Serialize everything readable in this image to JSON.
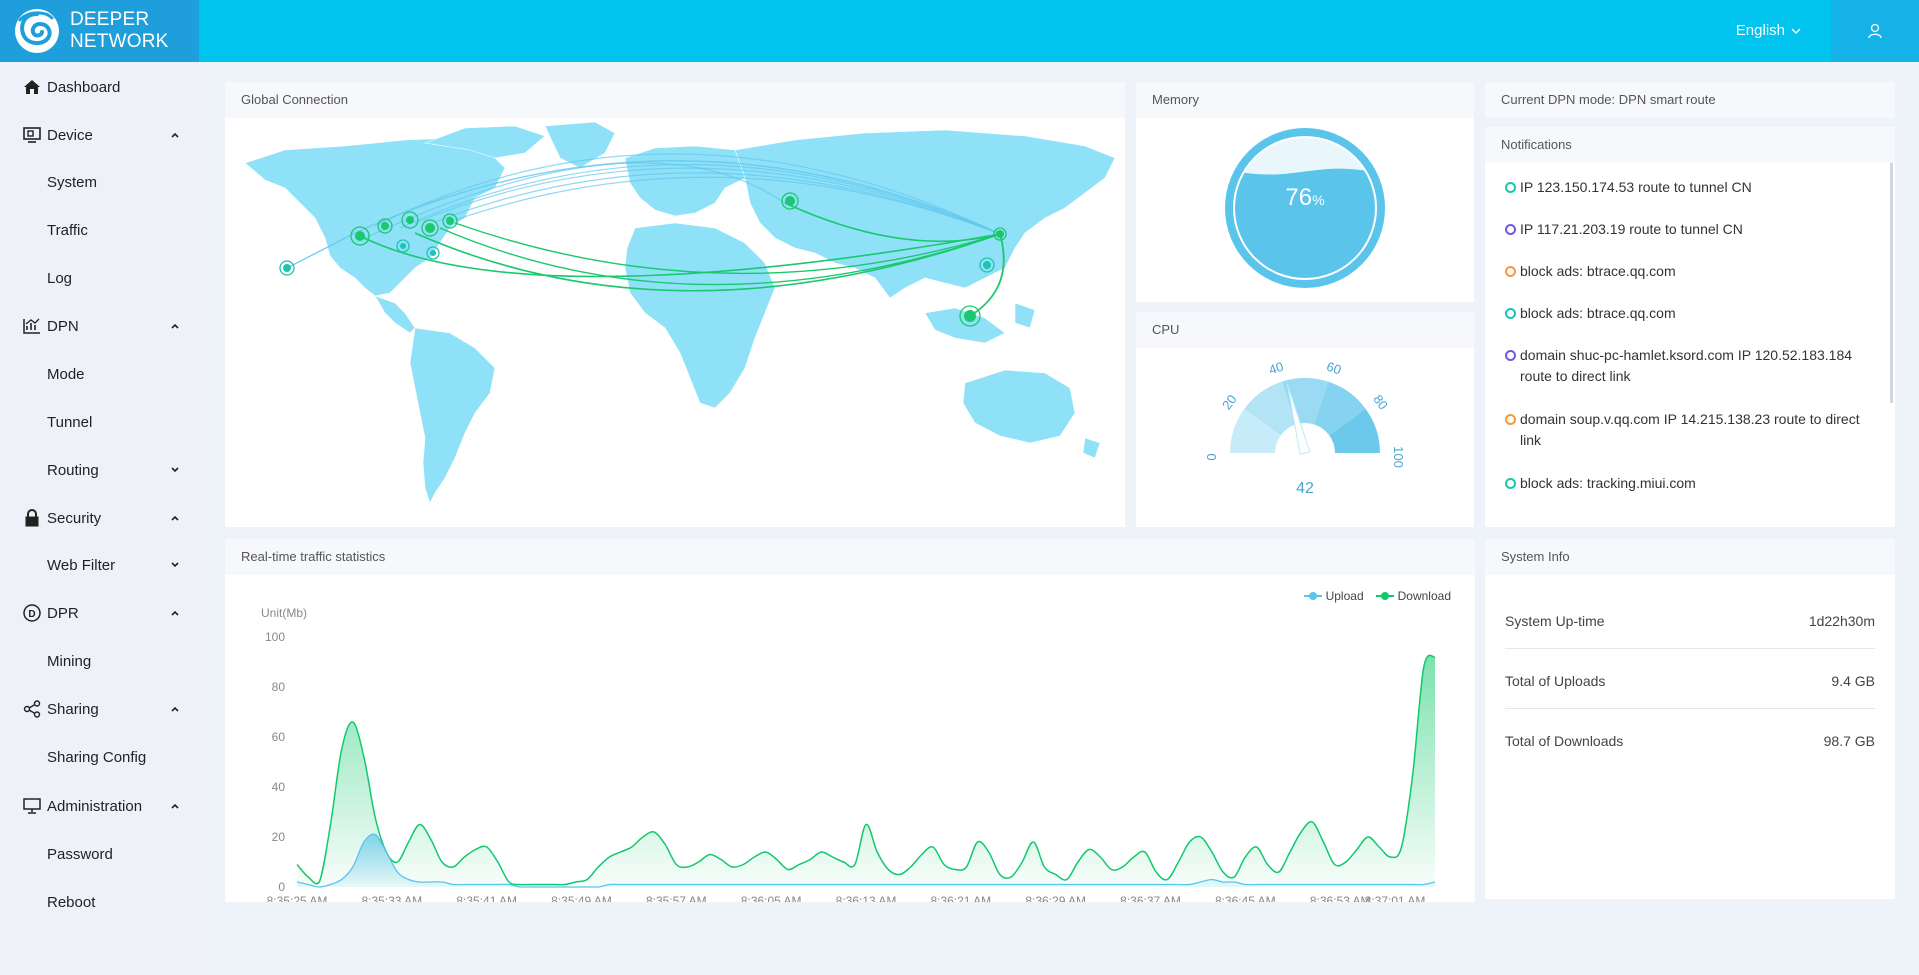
{
  "brand": {
    "line1": "DEEPER",
    "line2": "NETWORK"
  },
  "header": {
    "language": "English"
  },
  "sidebar": {
    "items": [
      {
        "label": "Dashboard",
        "icon": "home-icon"
      },
      {
        "label": "Device",
        "icon": "device-icon",
        "expanded": true
      },
      {
        "label": "System"
      },
      {
        "label": "Traffic"
      },
      {
        "label": "Log"
      },
      {
        "label": "DPN",
        "icon": "chart-icon",
        "expanded": true
      },
      {
        "label": "Mode"
      },
      {
        "label": "Tunnel"
      },
      {
        "label": "Routing",
        "expandable": true
      },
      {
        "label": "Security",
        "icon": "lock-icon",
        "expanded": true
      },
      {
        "label": "Web Filter",
        "expandable": true
      },
      {
        "label": "DPR",
        "icon": "dpr-coin-icon",
        "expanded": true
      },
      {
        "label": "Mining"
      },
      {
        "label": "Sharing",
        "icon": "share-icon",
        "expanded": true
      },
      {
        "label": "Sharing Config"
      },
      {
        "label": "Administration",
        "icon": "monitor-icon",
        "expanded": true
      },
      {
        "label": "Password"
      },
      {
        "label": "Reboot"
      }
    ]
  },
  "global_connection": {
    "title": "Global Connection"
  },
  "memory": {
    "title": "Memory",
    "value": "76",
    "unit": "%",
    "fraction": 0.76
  },
  "cpu": {
    "title": "CPU",
    "value": "42",
    "ticks": [
      "0",
      "20",
      "40",
      "60",
      "80",
      "100"
    ]
  },
  "dpn_mode": "Current DPN mode: DPN smart route",
  "notifications": {
    "title": "Notifications",
    "items": [
      {
        "text": "IP 123.150.174.53 route to tunnel CN",
        "color": "#1dc4b1"
      },
      {
        "text": "IP 117.21.203.19 route to tunnel CN",
        "color": "#6f5be0"
      },
      {
        "text": "block ads: btrace.qq.com",
        "color": "#f39a3d"
      },
      {
        "text": "block ads: btrace.qq.com",
        "color": "#1dc4b1"
      },
      {
        "text": "domain shuc-pc-hamlet.ksord.com IP 120.52.183.184 route to direct link",
        "color": "#6f5be0"
      },
      {
        "text": "domain soup.v.qq.com IP 14.215.138.23 route to direct link",
        "color": "#f39a3d"
      },
      {
        "text": "block ads: tracking.miui.com",
        "color": "#1dc4b1"
      }
    ]
  },
  "traffic": {
    "title": "Real-time traffic statistics",
    "unit_label": "Unit(Mb)",
    "legend_upload": "Upload",
    "legend_download": "Download"
  },
  "system_info": {
    "title": "System Info",
    "rows": [
      {
        "key": "System Up-time",
        "value": "1d22h30m"
      },
      {
        "key": "Total of Uploads",
        "value": "9.4 GB"
      },
      {
        "key": "Total of Downloads",
        "value": "98.7 GB"
      }
    ]
  },
  "colors": {
    "header": "#00c3ee",
    "logo_bg": "#1e9fdc",
    "upload": "#5bc4eb",
    "download": "#10c96b",
    "map": "#8fe1f8"
  },
  "chart_data": {
    "type": "area",
    "xlabel": "",
    "ylabel": "Unit(Mb)",
    "ylim": [
      0,
      100
    ],
    "yticks": [
      "0",
      "20",
      "40",
      "60",
      "80",
      "100"
    ],
    "xticks": [
      "8:35:25 AM",
      "8:35:33 AM",
      "8:35:41 AM",
      "8:35:49 AM",
      "8:35:57 AM",
      "8:36:05 AM",
      "8:36:13 AM",
      "8:36:21 AM",
      "8:36:29 AM",
      "8:36:37 AM",
      "8:36:45 AM",
      "8:36:53 AM",
      "8:37:01 AM"
    ],
    "x": [
      0,
      1,
      2,
      3,
      4,
      5,
      6,
      7,
      8,
      9,
      10,
      11,
      12,
      13,
      14,
      15,
      16,
      17,
      18,
      19,
      20,
      21,
      22,
      23,
      24,
      25,
      26,
      27,
      28,
      29,
      30,
      31,
      32,
      33,
      34,
      35,
      36,
      37,
      38,
      39,
      40,
      41,
      42,
      43,
      44,
      45,
      46,
      47,
      48,
      49,
      50,
      51,
      52,
      53,
      54,
      55,
      56,
      57,
      58,
      59,
      60,
      61,
      62,
      63,
      64,
      65,
      66,
      67,
      68,
      69,
      70,
      71,
      72,
      73,
      74,
      75,
      76,
      77,
      78,
      79,
      80,
      81,
      82,
      83,
      84,
      85,
      86,
      87,
      88,
      89,
      90,
      91,
      92,
      93,
      94,
      95,
      96,
      97,
      98,
      99,
      100,
      101,
      102
    ],
    "series": [
      {
        "name": "Upload",
        "values": [
          2,
          1,
          0,
          1,
          3,
          8,
          18,
          21,
          14,
          6,
          3,
          2,
          2,
          2,
          1,
          1,
          1,
          1,
          1,
          1,
          0,
          0,
          0,
          0,
          0,
          0,
          0,
          0,
          1,
          1,
          1,
          1,
          1,
          1,
          1,
          1,
          1,
          1,
          1,
          1,
          1,
          1,
          1,
          1,
          1,
          1,
          1,
          1,
          1,
          1,
          1,
          1,
          1,
          1,
          1,
          1,
          1,
          1,
          1,
          1,
          1,
          1,
          1,
          1,
          1,
          1,
          1,
          1,
          1,
          1,
          1,
          1,
          1,
          1,
          1,
          1,
          1,
          1,
          1,
          1,
          1,
          2,
          3,
          2,
          2,
          1,
          1,
          1,
          1,
          1,
          1,
          1,
          1,
          1,
          1,
          1,
          1,
          1,
          1,
          1,
          1,
          1,
          2
        ]
      },
      {
        "name": "Download",
        "values": [
          9,
          4,
          2,
          25,
          55,
          66,
          52,
          28,
          14,
          10,
          18,
          25,
          19,
          10,
          8,
          12,
          15,
          16,
          10,
          2,
          1,
          1,
          1,
          1,
          1,
          2,
          3,
          8,
          12,
          14,
          16,
          20,
          22,
          17,
          9,
          8,
          10,
          13,
          11,
          8,
          9,
          12,
          14,
          11,
          7,
          9,
          11,
          14,
          12,
          10,
          9,
          25,
          14,
          7,
          5,
          8,
          13,
          16,
          9,
          7,
          8,
          18,
          14,
          5,
          4,
          10,
          18,
          8,
          5,
          3,
          10,
          15,
          12,
          7,
          8,
          12,
          14,
          6,
          3,
          10,
          18,
          20,
          14,
          6,
          4,
          12,
          16,
          9,
          6,
          14,
          22,
          26,
          18,
          9,
          10,
          15,
          20,
          16,
          12,
          16,
          45,
          88,
          92
        ]
      }
    ]
  }
}
